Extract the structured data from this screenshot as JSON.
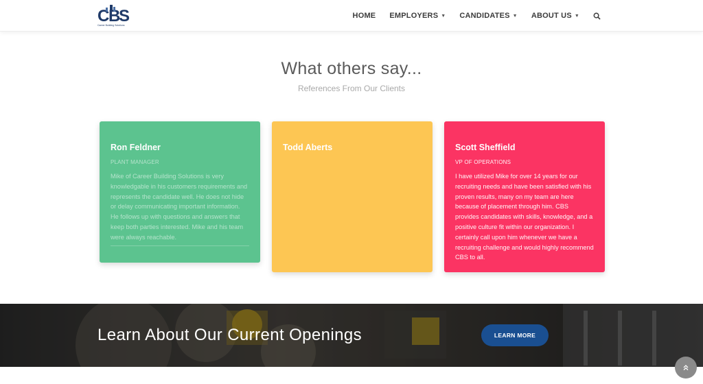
{
  "header": {
    "logo": {
      "letters": "CBS",
      "tagline": "Career Building Solutions",
      "color": "#1f3a68"
    },
    "nav": [
      {
        "label": "HOME",
        "dropdown": false
      },
      {
        "label": "EMPLOYERS",
        "dropdown": true
      },
      {
        "label": "CANDIDATES",
        "dropdown": true
      },
      {
        "label": "ABOUT US",
        "dropdown": true
      }
    ],
    "search_icon": "search-icon"
  },
  "testimonials": {
    "title": "What others say...",
    "subtitle": "References From Our Clients",
    "cards": [
      {
        "name": "Ron Feldner",
        "role": "PLANT MANAGER",
        "text": "Mike of Career Building Solutions is very knowledgable in his customers requirements and represents the candidate well. He does not hide or delay communicating important information. He follows up with questions and answers that keep both parties interested. Mike and his team were always reachable.",
        "color": "#5cc38f"
      },
      {
        "name": "Todd Aberts",
        "role": "",
        "text": "",
        "color": "#fdc653"
      },
      {
        "name": "Scott Sheffield",
        "role": "VP OF OPERATIONS",
        "text": "I have utilized Mike for over 14 years for our recruiting needs and have been satisfied with his proven results, many on my team are here because of placement through him.  CBS provides candidates with skills, knowledge, and a positive culture fit within our organization.  I certainly call upon him whenever we have a recruiting challenge and would highly recommend CBS to all.",
        "color": "#fb3463"
      }
    ]
  },
  "banner": {
    "title": "Learn About Our Current Openings",
    "button": "LEARN MORE",
    "button_color": "#1a4f91"
  },
  "scroll_top_icon": "double-chevron-up-icon"
}
